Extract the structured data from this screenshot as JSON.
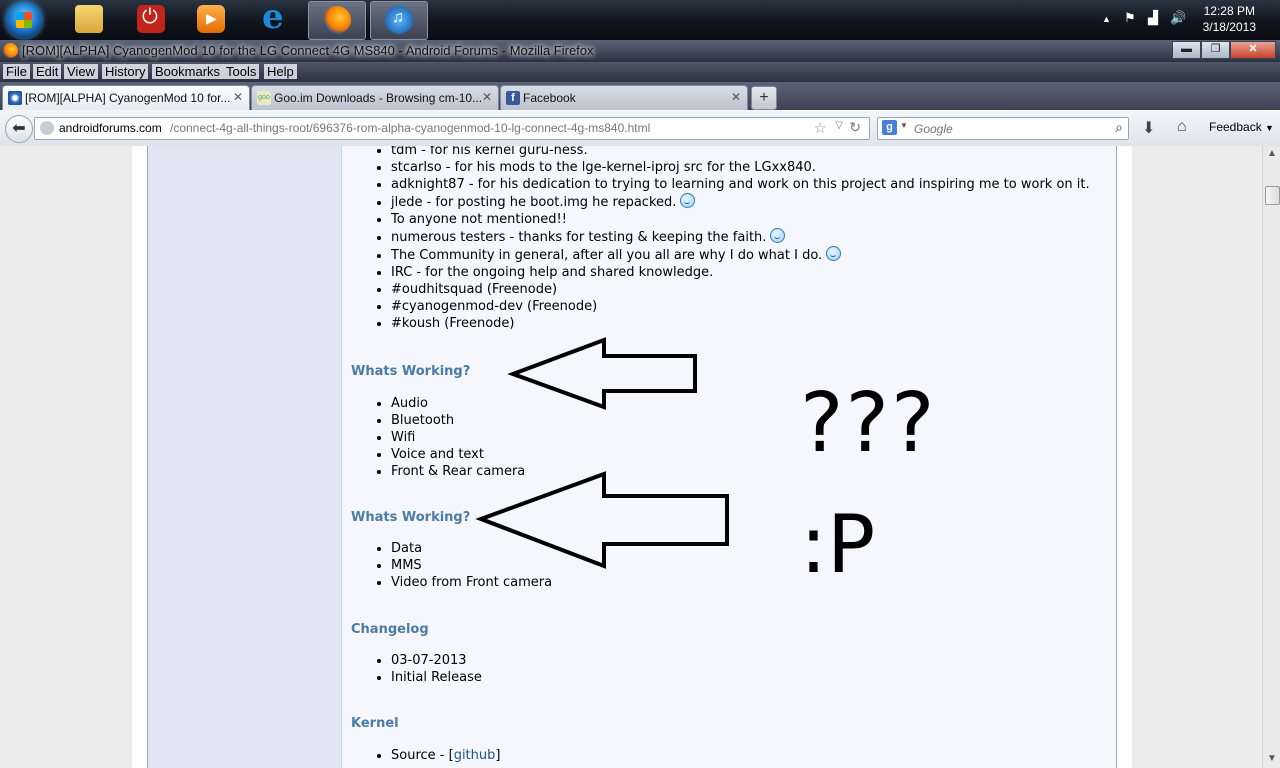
{
  "taskbar": {
    "apps": [
      {
        "name": "windows-explorer",
        "active": false
      },
      {
        "name": "power-app",
        "active": false
      },
      {
        "name": "media-player",
        "active": false
      },
      {
        "name": "internet-explorer",
        "active": false
      },
      {
        "name": "firefox",
        "active": true
      },
      {
        "name": "itunes",
        "active": false
      }
    ],
    "time": "12:28 PM",
    "date": "3/18/2013"
  },
  "window": {
    "title": "[ROM][ALPHA] CyanogenMod 10 for the LG Connect 4G MS840 - Android Forums - Mozilla Firefox",
    "minimize": "▬",
    "restore": "❐",
    "close": "✕"
  },
  "menu": [
    "File",
    "Edit",
    "View",
    "History",
    "Bookmarks",
    "Tools",
    "Help"
  ],
  "tabs": [
    {
      "label": "[ROM][ALPHA] CyanogenMod 10 for...",
      "close": "✕"
    },
    {
      "label": "Goo.im Downloads - Browsing cm-10...",
      "close": "✕"
    },
    {
      "label": "Facebook",
      "close": "✕"
    }
  ],
  "newtab": "+",
  "nav": {
    "url_domain": "androidforums.com",
    "url_path": "/connect-4g-all-things-root/696376-rom-alpha-cyanogenmod-10-lg-connect-4g-ms840.html",
    "search_placeholder": "Google",
    "feedback": "Feedback"
  },
  "post": {
    "credits": [
      {
        "text": "tdm - for his kernel guru-ness.",
        "smiley": false
      },
      {
        "text": "stcarlso - for his mods to the lge-kernel-iproj src for the LGxx840.",
        "smiley": false
      },
      {
        "text": "adknight87 - for his dedication to trying to learning and work on this project and inspiring me to work on it.",
        "smiley": false
      },
      {
        "text": "jlede - for posting he boot.img he repacked.",
        "smiley": true
      },
      {
        "text": "To anyone not mentioned!!",
        "smiley": false
      },
      {
        "text": "numerous testers - thanks for testing & keeping the faith.",
        "smiley": true
      },
      {
        "text": "The Community in general, after all you all are why I do what I do.",
        "smiley": true
      },
      {
        "text": "IRC - for the ongoing help and shared knowledge.",
        "smiley": false
      },
      {
        "text": "#oudhitsquad (Freenode)",
        "smiley": false
      },
      {
        "text": "#cyanogenmod-dev (Freenode)",
        "smiley": false
      },
      {
        "text": "#koush (Freenode)",
        "smiley": false
      }
    ],
    "working_title": "Whats Working?",
    "working": [
      "Audio",
      "Bluetooth",
      "Wifi",
      "Voice and text",
      "Front & Rear camera"
    ],
    "notworking_title": "Whats Working?",
    "notworking": [
      "Data",
      "MMS",
      "Video from Front camera"
    ],
    "changelog_title": "Changelog",
    "changelog": [
      "03-07-2013",
      "Initial Release"
    ],
    "kernel_title": "Kernel",
    "kernel_source_label": "Source - ",
    "kernel_link": "github"
  },
  "annotations": {
    "question": "???",
    "tongue": ":P"
  }
}
